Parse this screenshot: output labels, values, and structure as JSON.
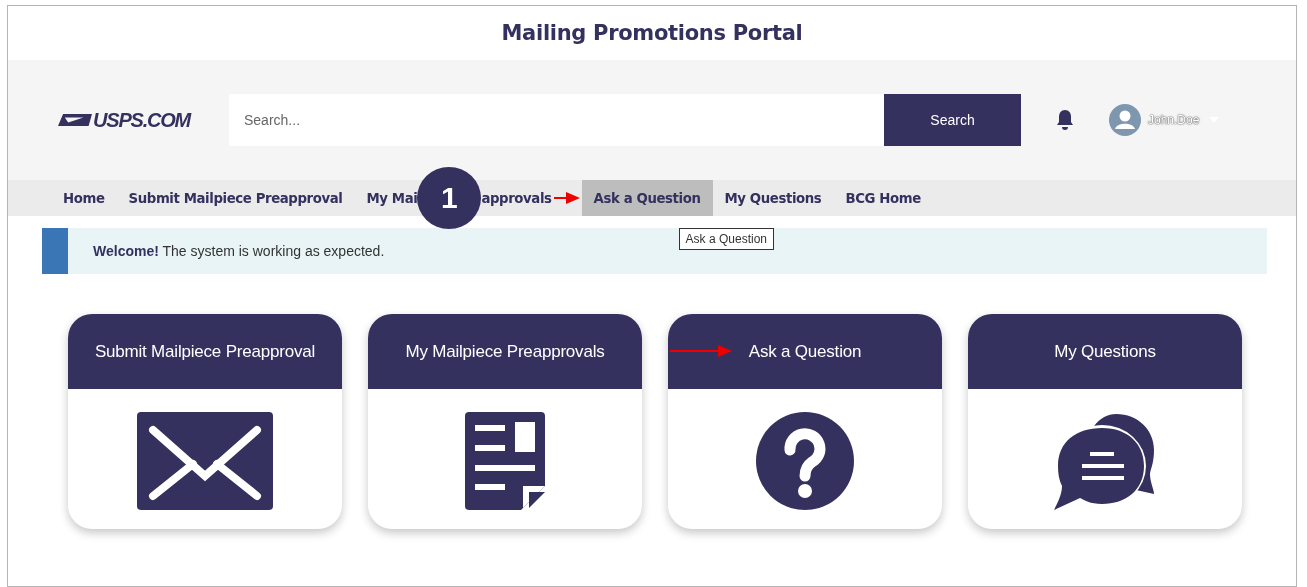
{
  "window": {
    "title": "Mailing Promotions Portal"
  },
  "header": {
    "logo": "USPS.COM",
    "search": {
      "placeholder": "Search..."
    },
    "search_button": "Search",
    "user": {
      "name": "John.Doe"
    }
  },
  "nav": [
    {
      "label": "Home",
      "selected": false
    },
    {
      "label": "Submit Mailpiece Preapproval",
      "selected": false
    },
    {
      "label": "My Mai",
      "label_after_badge": "approvals",
      "selected": false
    },
    {
      "label": "Ask a Question",
      "selected": true
    },
    {
      "label": "My Questions",
      "selected": false
    },
    {
      "label": "BCG Home",
      "selected": false
    }
  ],
  "tooltip": "Ask a Question",
  "banner": {
    "text": "**Welcome!** The system is working as expected."
  },
  "cards": [
    {
      "title": "Submit Mailpiece Preapproval",
      "kind": "envelope",
      "pointer": false
    },
    {
      "title": "My Mailpiece Preapprovals",
      "kind": "document",
      "pointer": false
    },
    {
      "title": "Ask a Question",
      "kind": "question",
      "pointer": true
    },
    {
      "title": "My Questions",
      "kind": "chat",
      "pointer": false
    }
  ],
  "step_badge": "1"
}
